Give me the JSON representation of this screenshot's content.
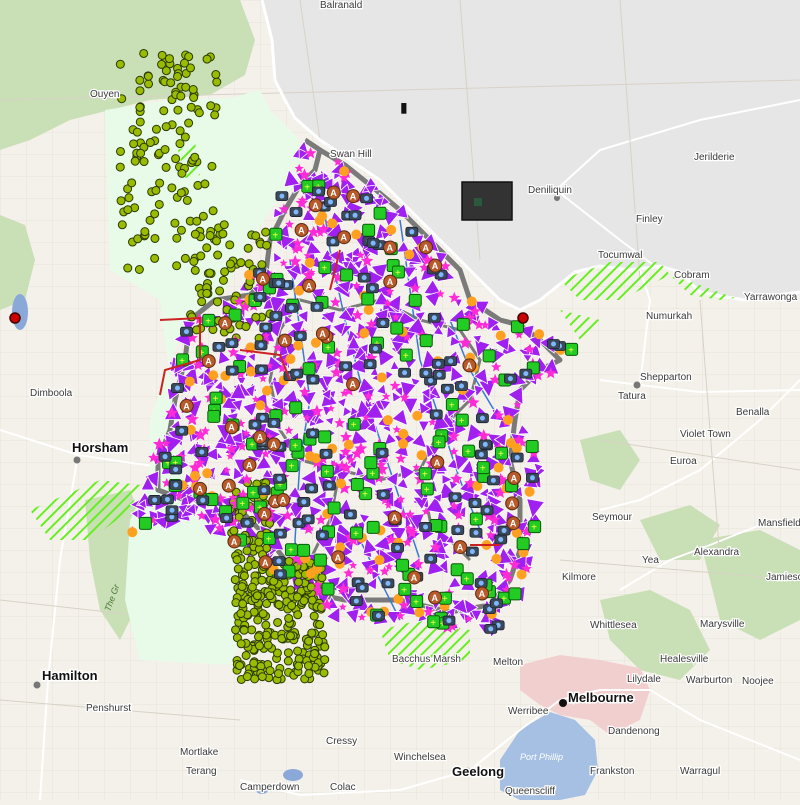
{
  "map": {
    "colors": {
      "base": "#f4f1ea",
      "nsw": "#e6e6e6",
      "forest": "#c9dfb6",
      "region": "#e8fbe8",
      "region_outline": "#7a7a7a",
      "purple": "#a020f0",
      "magenta": "#ff2bd6",
      "orange": "#ffa020",
      "green_fill": "#22cc22",
      "olive": "#99bb00",
      "hatch": "#66ee22",
      "road": "#ffffff",
      "river": "#3a78d8",
      "lake": "#8aa9d8",
      "bay": "#a6c0e4",
      "urban": "#f2cfcf"
    },
    "towns": [
      {
        "id": "balranald",
        "name": "Balranald"
      },
      {
        "id": "ouyen",
        "name": "Ouyen"
      },
      {
        "id": "swan-hill",
        "name": "Swan Hill"
      },
      {
        "id": "deniliquin",
        "name": "Deniliquin"
      },
      {
        "id": "jerilderie",
        "name": "Jerilderie"
      },
      {
        "id": "finley",
        "name": "Finley"
      },
      {
        "id": "tocumwal",
        "name": "Tocumwal"
      },
      {
        "id": "cobram",
        "name": "Cobram"
      },
      {
        "id": "yarrawonga",
        "name": "Yarrawonga"
      },
      {
        "id": "numurkah",
        "name": "Numurkah"
      },
      {
        "id": "shepparton",
        "name": "Shepparton"
      },
      {
        "id": "tatura",
        "name": "Tatura"
      },
      {
        "id": "benalla",
        "name": "Benalla"
      },
      {
        "id": "violet-town",
        "name": "Violet Town"
      },
      {
        "id": "euroa",
        "name": "Euroa"
      },
      {
        "id": "seymour",
        "name": "Seymour"
      },
      {
        "id": "mansfield",
        "name": "Mansfield"
      },
      {
        "id": "alexandra",
        "name": "Alexandra"
      },
      {
        "id": "jamieson",
        "name": "Jamieso"
      },
      {
        "id": "yea",
        "name": "Yea"
      },
      {
        "id": "kilmore",
        "name": "Kilmore"
      },
      {
        "id": "whittlesea",
        "name": "Whittlesea"
      },
      {
        "id": "marysville",
        "name": "Marysville"
      },
      {
        "id": "healesville",
        "name": "Healesville"
      },
      {
        "id": "lilydale",
        "name": "Lilydale"
      },
      {
        "id": "warburton",
        "name": "Warburton"
      },
      {
        "id": "noojee",
        "name": "Noojee"
      },
      {
        "id": "dandenong",
        "name": "Dandenong"
      },
      {
        "id": "frankston",
        "name": "Frankston"
      },
      {
        "id": "warragul",
        "name": "Warragul"
      },
      {
        "id": "melton",
        "name": "Melton"
      },
      {
        "id": "bacchus-marsh",
        "name": "Bacchus Marsh"
      },
      {
        "id": "werribee",
        "name": "Werribee"
      },
      {
        "id": "geelong",
        "name": "Geelong"
      },
      {
        "id": "queenscliff",
        "name": "Queenscliff"
      },
      {
        "id": "winchelsea",
        "name": "Winchelsea"
      },
      {
        "id": "colac",
        "name": "Colac"
      },
      {
        "id": "camperdown",
        "name": "Camperdown"
      },
      {
        "id": "terang",
        "name": "Terang"
      },
      {
        "id": "mortlake",
        "name": "Mortlake"
      },
      {
        "id": "cressy",
        "name": "Cressy"
      },
      {
        "id": "penshurst",
        "name": "Penshurst"
      },
      {
        "id": "hamilton",
        "name": "Hamilton"
      },
      {
        "id": "horsham",
        "name": "Horsham"
      },
      {
        "id": "dimboola",
        "name": "Dimboola"
      }
    ],
    "melbourne": "Melbourne",
    "port_phillip": "Port Phillip",
    "grampians": "The Gr"
  }
}
